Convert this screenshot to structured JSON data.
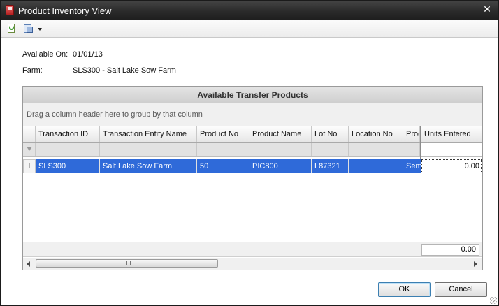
{
  "window": {
    "title": "Product Inventory View",
    "close_glyph": "✕"
  },
  "toolbar": {
    "icons": [
      "refresh-icon",
      "export-icon",
      "dropdown-arrow-icon"
    ]
  },
  "info": {
    "available_on_label": "Available On:",
    "available_on_value": "01/01/13",
    "farm_label": "Farm:",
    "farm_value": "SLS300 - Salt Lake Sow Farm"
  },
  "grid": {
    "caption": "Available Transfer Products",
    "group_hint": "Drag a column header here to group by that column",
    "columns": [
      "Transaction ID",
      "Transaction Entity Name",
      "Product No",
      "Product Name",
      "Lot No",
      "Location No",
      "Prod",
      "Units Entered"
    ],
    "rows": [
      {
        "transaction_id": "SLS300",
        "transaction_entity_name": "Salt Lake Sow Farm",
        "product_no": "50",
        "product_name": "PIC800",
        "lot_no": "L87321",
        "location_no": "",
        "prod": "Sem",
        "units_entered": "0.00",
        "row_indicator": "I"
      }
    ],
    "summary_units_entered": "0.00",
    "colors": {
      "selected_row": "#2f6ad9",
      "header": "#e6e6e6"
    }
  },
  "buttons": {
    "ok": "OK",
    "cancel": "Cancel"
  }
}
